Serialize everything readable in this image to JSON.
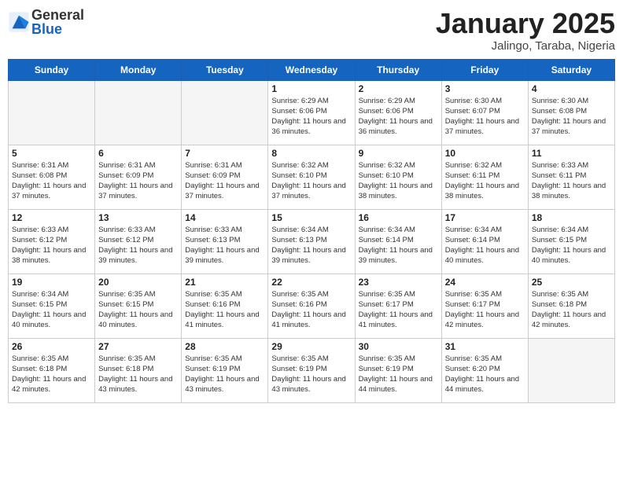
{
  "header": {
    "logo_general": "General",
    "logo_blue": "Blue",
    "month_title": "January 2025",
    "location": "Jalingo, Taraba, Nigeria"
  },
  "days_of_week": [
    "Sunday",
    "Monday",
    "Tuesday",
    "Wednesday",
    "Thursday",
    "Friday",
    "Saturday"
  ],
  "weeks": [
    [
      {
        "day": "",
        "info": ""
      },
      {
        "day": "",
        "info": ""
      },
      {
        "day": "",
        "info": ""
      },
      {
        "day": "1",
        "info": "Sunrise: 6:29 AM\nSunset: 6:06 PM\nDaylight: 11 hours and 36 minutes."
      },
      {
        "day": "2",
        "info": "Sunrise: 6:29 AM\nSunset: 6:06 PM\nDaylight: 11 hours and 36 minutes."
      },
      {
        "day": "3",
        "info": "Sunrise: 6:30 AM\nSunset: 6:07 PM\nDaylight: 11 hours and 37 minutes."
      },
      {
        "day": "4",
        "info": "Sunrise: 6:30 AM\nSunset: 6:08 PM\nDaylight: 11 hours and 37 minutes."
      }
    ],
    [
      {
        "day": "5",
        "info": "Sunrise: 6:31 AM\nSunset: 6:08 PM\nDaylight: 11 hours and 37 minutes."
      },
      {
        "day": "6",
        "info": "Sunrise: 6:31 AM\nSunset: 6:09 PM\nDaylight: 11 hours and 37 minutes."
      },
      {
        "day": "7",
        "info": "Sunrise: 6:31 AM\nSunset: 6:09 PM\nDaylight: 11 hours and 37 minutes."
      },
      {
        "day": "8",
        "info": "Sunrise: 6:32 AM\nSunset: 6:10 PM\nDaylight: 11 hours and 37 minutes."
      },
      {
        "day": "9",
        "info": "Sunrise: 6:32 AM\nSunset: 6:10 PM\nDaylight: 11 hours and 38 minutes."
      },
      {
        "day": "10",
        "info": "Sunrise: 6:32 AM\nSunset: 6:11 PM\nDaylight: 11 hours and 38 minutes."
      },
      {
        "day": "11",
        "info": "Sunrise: 6:33 AM\nSunset: 6:11 PM\nDaylight: 11 hours and 38 minutes."
      }
    ],
    [
      {
        "day": "12",
        "info": "Sunrise: 6:33 AM\nSunset: 6:12 PM\nDaylight: 11 hours and 38 minutes."
      },
      {
        "day": "13",
        "info": "Sunrise: 6:33 AM\nSunset: 6:12 PM\nDaylight: 11 hours and 39 minutes."
      },
      {
        "day": "14",
        "info": "Sunrise: 6:33 AM\nSunset: 6:13 PM\nDaylight: 11 hours and 39 minutes."
      },
      {
        "day": "15",
        "info": "Sunrise: 6:34 AM\nSunset: 6:13 PM\nDaylight: 11 hours and 39 minutes."
      },
      {
        "day": "16",
        "info": "Sunrise: 6:34 AM\nSunset: 6:14 PM\nDaylight: 11 hours and 39 minutes."
      },
      {
        "day": "17",
        "info": "Sunrise: 6:34 AM\nSunset: 6:14 PM\nDaylight: 11 hours and 40 minutes."
      },
      {
        "day": "18",
        "info": "Sunrise: 6:34 AM\nSunset: 6:15 PM\nDaylight: 11 hours and 40 minutes."
      }
    ],
    [
      {
        "day": "19",
        "info": "Sunrise: 6:34 AM\nSunset: 6:15 PM\nDaylight: 11 hours and 40 minutes."
      },
      {
        "day": "20",
        "info": "Sunrise: 6:35 AM\nSunset: 6:15 PM\nDaylight: 11 hours and 40 minutes."
      },
      {
        "day": "21",
        "info": "Sunrise: 6:35 AM\nSunset: 6:16 PM\nDaylight: 11 hours and 41 minutes."
      },
      {
        "day": "22",
        "info": "Sunrise: 6:35 AM\nSunset: 6:16 PM\nDaylight: 11 hours and 41 minutes."
      },
      {
        "day": "23",
        "info": "Sunrise: 6:35 AM\nSunset: 6:17 PM\nDaylight: 11 hours and 41 minutes."
      },
      {
        "day": "24",
        "info": "Sunrise: 6:35 AM\nSunset: 6:17 PM\nDaylight: 11 hours and 42 minutes."
      },
      {
        "day": "25",
        "info": "Sunrise: 6:35 AM\nSunset: 6:18 PM\nDaylight: 11 hours and 42 minutes."
      }
    ],
    [
      {
        "day": "26",
        "info": "Sunrise: 6:35 AM\nSunset: 6:18 PM\nDaylight: 11 hours and 42 minutes."
      },
      {
        "day": "27",
        "info": "Sunrise: 6:35 AM\nSunset: 6:18 PM\nDaylight: 11 hours and 43 minutes."
      },
      {
        "day": "28",
        "info": "Sunrise: 6:35 AM\nSunset: 6:19 PM\nDaylight: 11 hours and 43 minutes."
      },
      {
        "day": "29",
        "info": "Sunrise: 6:35 AM\nSunset: 6:19 PM\nDaylight: 11 hours and 43 minutes."
      },
      {
        "day": "30",
        "info": "Sunrise: 6:35 AM\nSunset: 6:19 PM\nDaylight: 11 hours and 44 minutes."
      },
      {
        "day": "31",
        "info": "Sunrise: 6:35 AM\nSunset: 6:20 PM\nDaylight: 11 hours and 44 minutes."
      },
      {
        "day": "",
        "info": ""
      }
    ]
  ]
}
